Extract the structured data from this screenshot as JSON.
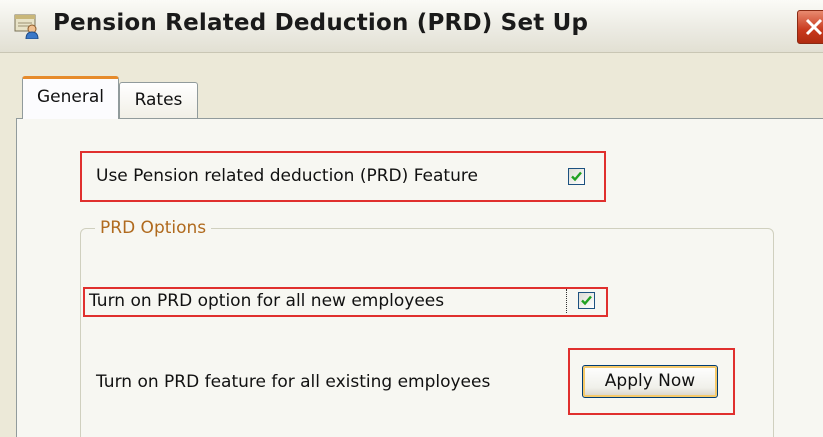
{
  "window": {
    "title": "Pension Related Deduction (PRD) Set Up",
    "icon": "people-settings-icon",
    "close_icon": "close-x-icon"
  },
  "tabs": [
    {
      "label": "General",
      "selected": true
    },
    {
      "label": "Rates",
      "selected": false
    }
  ],
  "general": {
    "use_prd_feature": {
      "label": "Use Pension related deduction (PRD) Feature",
      "checked": true
    },
    "prd_options": {
      "group_label": "PRD Options",
      "new_employees": {
        "label": "Turn on PRD option for all new employees",
        "checked": true
      },
      "existing_employees": {
        "label": "Turn on PRD feature for all existing employees",
        "button_label": "Apply Now"
      }
    }
  },
  "colors": {
    "highlight_red": "#e0302e",
    "tab_accent": "#e68b2c",
    "group_title": "#b06a1e",
    "checkbox_check": "#21a121"
  }
}
